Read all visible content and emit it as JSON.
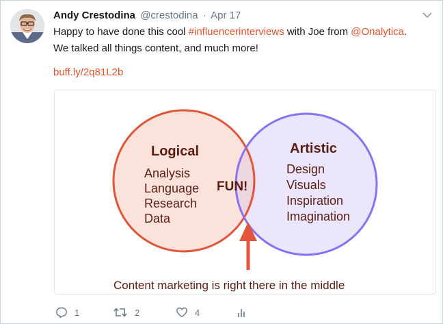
{
  "tweet": {
    "author_name": "Andy Crestodina",
    "author_handle": "@crestodina",
    "separator": "·",
    "date": "Apr 17",
    "text_before_hashtag": "Happy to have done this cool ",
    "hashtag": "#influencerinterviews",
    "text_between": " with Joe from ",
    "mention": "@Onalytica",
    "text_after_mention": ".",
    "text_line2": "We talked all things content, and much more!",
    "link": "buff.ly/2q81L2b"
  },
  "card": {
    "left_title": "Logical",
    "left_items": [
      "Analysis",
      "Language",
      "Research",
      "Data"
    ],
    "right_title": "Artistic",
    "right_items": [
      "Design",
      "Visuals",
      "Inspiration",
      "Imagination"
    ],
    "center_label": "FUN!",
    "caption": "Content marketing is right there in the middle",
    "colors": {
      "left_fill": "#fbe3dc",
      "left_stroke": "#e2553b",
      "right_fill": "#ebe6fb",
      "right_stroke": "#8872f4",
      "overlap_fill": "#ecd6e0",
      "arrow": "#e2553b",
      "text": "#5a1d12"
    }
  },
  "actions": {
    "reply_count": "1",
    "retweet_count": "2",
    "like_count": "4"
  },
  "icons": [
    "avatar-photo",
    "chevron-down-icon",
    "reply-icon",
    "retweet-icon",
    "like-icon",
    "analytics-icon"
  ],
  "colors": {
    "link": "#e0522c",
    "muted": "#657786",
    "border": "#c9d3dc"
  }
}
